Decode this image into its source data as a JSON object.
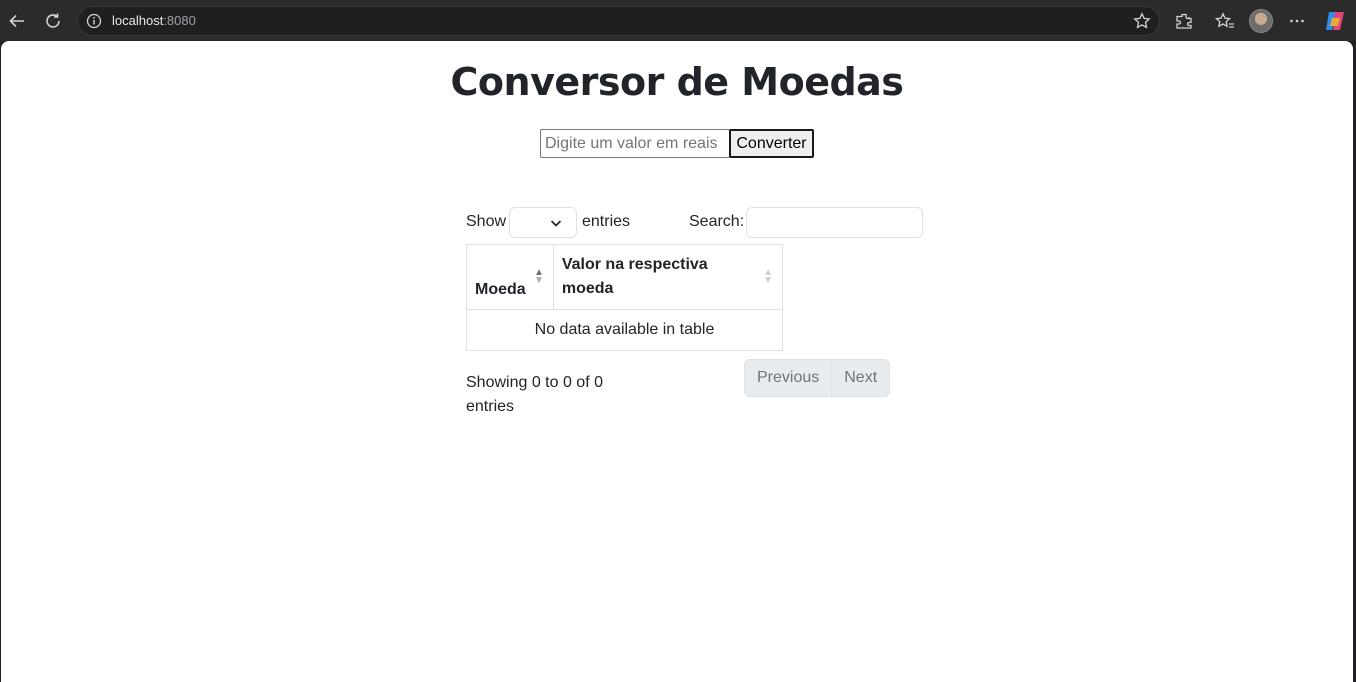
{
  "browser": {
    "url_host": "localhost",
    "url_port": ":8080",
    "icons": [
      "back-icon",
      "reload-icon",
      "info-icon",
      "star-icon",
      "extensions-icon",
      "favorites-icon",
      "profile-avatar",
      "more-icon",
      "copilot-icon"
    ]
  },
  "page": {
    "title": "Conversor de Moedas",
    "converter": {
      "placeholder": "Digite um valor em reais",
      "button_label": "Converter"
    },
    "datatable": {
      "show_label": "Show",
      "entries_label": "entries",
      "search_label": "Search:",
      "columns": [
        "Moeda",
        "Valor na respectiva moeda"
      ],
      "empty_message": "No data available in table",
      "info": "Showing 0 to 0 of 0 entries",
      "previous_label": "Previous",
      "next_label": "Next"
    }
  }
}
